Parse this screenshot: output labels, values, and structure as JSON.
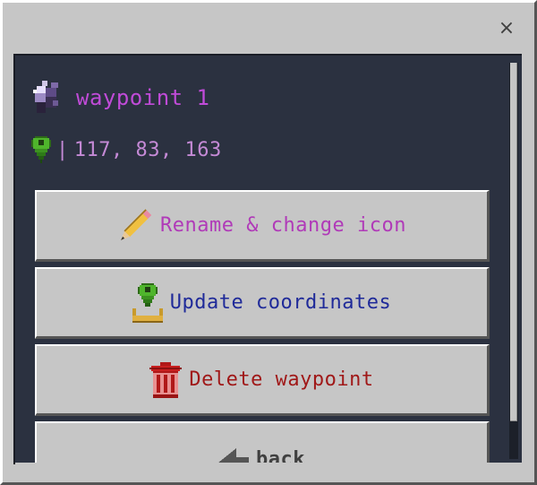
{
  "window": {
    "close_label": "×"
  },
  "waypoint": {
    "name": "waypoint 1",
    "coordinates": "117, 83, 163",
    "coords_separator": "|"
  },
  "buttons": [
    {
      "label": "Rename & change icon",
      "icon": "pencil-icon"
    },
    {
      "label": "Update coordinates",
      "icon": "pin-download-icon"
    },
    {
      "label": "Delete waypoint",
      "icon": "trash-icon"
    },
    {
      "label": "back",
      "icon": "back-arrow-icon"
    }
  ],
  "colors": {
    "rename": "#b03ab8",
    "update": "#1f2a99",
    "delete": "#a01818",
    "waypoint_name": "#c04bd8",
    "coords": "#c58ad6"
  }
}
